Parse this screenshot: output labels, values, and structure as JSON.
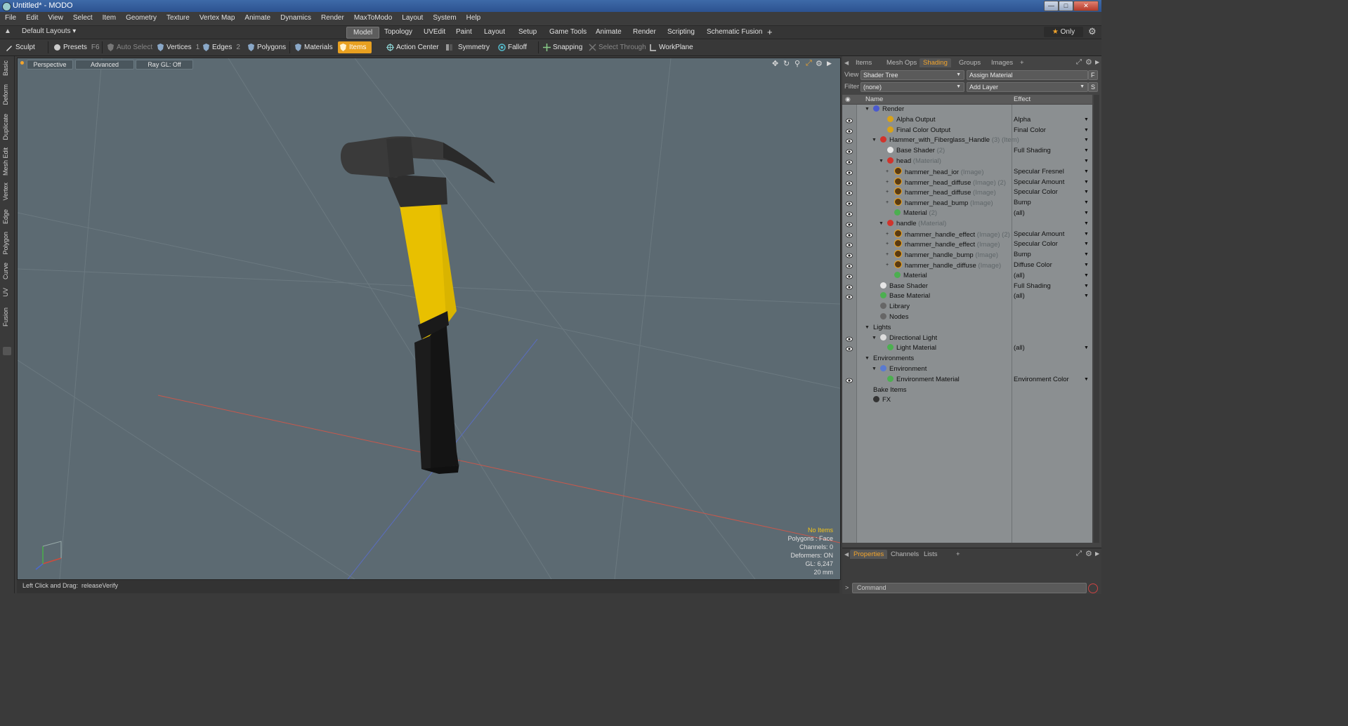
{
  "window": {
    "title": "Untitled* - MODO",
    "controls": [
      "minimize",
      "maximize",
      "close"
    ]
  },
  "menu": [
    "File",
    "Edit",
    "View",
    "Select",
    "Item",
    "Geometry",
    "Texture",
    "Vertex Map",
    "Animate",
    "Dynamics",
    "Render",
    "MaxToModo",
    "Layout",
    "System",
    "Help"
  ],
  "layout_bar": {
    "preset": "Default Layouts",
    "tabs": [
      "Model",
      "Topology",
      "UVEdit",
      "Paint",
      "Layout",
      "Setup",
      "Game Tools",
      "Animate",
      "Render",
      "Scripting",
      "Schematic Fusion"
    ],
    "active_tab": "Model",
    "add": "+",
    "only_label": "Only"
  },
  "toolbar": {
    "sculpt": "Sculpt",
    "presets": "Presets",
    "presets_key": "F6",
    "auto_select": "Auto Select",
    "vertices": "Vertices",
    "vertices_key": "1",
    "edges": "Edges",
    "edges_key": "2",
    "polygons": "Polygons",
    "materials": "Materials",
    "items": "Items",
    "action_center": "Action Center",
    "symmetry": "Symmetry",
    "falloff": "Falloff",
    "snapping": "Snapping",
    "select_through": "Select Through",
    "workplane": "WorkPlane"
  },
  "left_tabs": [
    "Basic",
    "Deform",
    "Duplicate",
    "Mesh Edit",
    "Vertex",
    "Edge",
    "Polygon",
    "Curve",
    "UV",
    "Fusion"
  ],
  "viewport": {
    "view": "Perspective",
    "shading": "Advanced",
    "raygl": "Ray GL: Off",
    "hud": {
      "selection": "No Items",
      "polygons": "Polygons : Face",
      "channels": "Channels: 0",
      "deformers": "Deformers: ON",
      "gl": "GL: 6,247",
      "scale": "20 mm"
    }
  },
  "status_bar": {
    "hint": "Left Click and Drag:",
    "action": "releaseVerify"
  },
  "right_panel": {
    "tabs": [
      "Items",
      "Mesh Ops",
      "Shading",
      "Groups",
      "Images",
      "+"
    ],
    "active_tab": "Shading",
    "view_label": "View",
    "view_value": "Shader Tree",
    "assign_material": "Assign Material",
    "f_button": "F",
    "filter_label": "Filter",
    "filter_value": "(none)",
    "add_layer": "Add Layer",
    "s_button": "S",
    "columns": {
      "name": "Name",
      "effect": "Effect"
    },
    "tree": [
      {
        "name": "Render",
        "sub": "",
        "effect": "",
        "icon": "sphere-blue",
        "level": 0,
        "eye": false,
        "toggle": "down"
      },
      {
        "name": "Alpha Output",
        "sub": "",
        "effect": "Alpha",
        "icon": "output",
        "level": 2,
        "eye": true,
        "toggle": ""
      },
      {
        "name": "Final Color Output",
        "sub": "",
        "effect": "Final Color",
        "icon": "output",
        "level": 2,
        "eye": true,
        "toggle": ""
      },
      {
        "name": "Hammer_with_Fiberglass_Handle",
        "sub": "(3) (Item)",
        "effect": "",
        "icon": "mask-red",
        "level": 1,
        "eye": true,
        "toggle": "down"
      },
      {
        "name": "Base Shader",
        "sub": "(2)",
        "effect": "Full Shading",
        "icon": "sphere-white",
        "level": 2,
        "eye": true,
        "toggle": ""
      },
      {
        "name": "head",
        "sub": "(Material)",
        "effect": "",
        "icon": "mask-red",
        "level": 2,
        "eye": true,
        "toggle": "down"
      },
      {
        "name": "hammer_head_ior",
        "sub": "(Image)",
        "effect": "Specular Fresnel",
        "icon": "image",
        "level": 3,
        "eye": true,
        "toggle": "plus"
      },
      {
        "name": "hammer_head_diffuse",
        "sub": "(Image) (2)",
        "effect": "Specular Amount",
        "icon": "image",
        "level": 3,
        "eye": true,
        "toggle": "plus"
      },
      {
        "name": "hammer_head_diffuse",
        "sub": "(Image)",
        "effect": "Specular Color",
        "icon": "image",
        "level": 3,
        "eye": true,
        "toggle": "plus"
      },
      {
        "name": "hammer_head_bump",
        "sub": "(Image)",
        "effect": "Bump",
        "icon": "image",
        "level": 3,
        "eye": true,
        "toggle": "plus"
      },
      {
        "name": "Material",
        "sub": "(2)",
        "effect": "(all)",
        "icon": "sphere-green",
        "level": 3,
        "eye": true,
        "toggle": ""
      },
      {
        "name": "handle",
        "sub": "(Material)",
        "effect": "",
        "icon": "mask-red",
        "level": 2,
        "eye": true,
        "toggle": "down"
      },
      {
        "name": "rhammer_handle_effect",
        "sub": "(Image) (2)",
        "effect": "Specular Amount",
        "icon": "image",
        "level": 3,
        "eye": true,
        "toggle": "plus"
      },
      {
        "name": "rhammer_handle_effect",
        "sub": "(Image)",
        "effect": "Specular Color",
        "icon": "image",
        "level": 3,
        "eye": true,
        "toggle": "plus"
      },
      {
        "name": "hammer_handle_bump",
        "sub": "(Image)",
        "effect": "Bump",
        "icon": "image",
        "level": 3,
        "eye": true,
        "toggle": "plus"
      },
      {
        "name": "hammer_handle_diffuse",
        "sub": "(Image)",
        "effect": "Diffuse Color",
        "icon": "image",
        "level": 3,
        "eye": true,
        "toggle": "plus"
      },
      {
        "name": "Material",
        "sub": "",
        "effect": "(all)",
        "icon": "sphere-green",
        "level": 3,
        "eye": true,
        "toggle": ""
      },
      {
        "name": "Base Shader",
        "sub": "",
        "effect": "Full Shading",
        "icon": "sphere-white",
        "level": 1,
        "eye": true,
        "toggle": ""
      },
      {
        "name": "Base Material",
        "sub": "",
        "effect": "(all)",
        "icon": "sphere-green",
        "level": 1,
        "eye": true,
        "toggle": ""
      },
      {
        "name": "Library",
        "sub": "",
        "effect": "",
        "icon": "folder",
        "level": 1,
        "eye": false,
        "toggle": ""
      },
      {
        "name": "Nodes",
        "sub": "",
        "effect": "",
        "icon": "folder",
        "level": 1,
        "eye": false,
        "toggle": ""
      },
      {
        "name": "Lights",
        "sub": "",
        "effect": "",
        "icon": "",
        "level": 0,
        "eye": false,
        "toggle": "down"
      },
      {
        "name": "Directional Light",
        "sub": "",
        "effect": "",
        "icon": "light",
        "level": 1,
        "eye": true,
        "toggle": "down"
      },
      {
        "name": "Light Material",
        "sub": "",
        "effect": "(all)",
        "icon": "sphere-green",
        "level": 2,
        "eye": true,
        "toggle": ""
      },
      {
        "name": "Environments",
        "sub": "",
        "effect": "",
        "icon": "",
        "level": 0,
        "eye": false,
        "toggle": "down"
      },
      {
        "name": "Environment",
        "sub": "",
        "effect": "",
        "icon": "env",
        "level": 1,
        "eye": false,
        "toggle": "down"
      },
      {
        "name": "Environment Material",
        "sub": "",
        "effect": "Environment Color",
        "icon": "sphere-green",
        "level": 2,
        "eye": true,
        "toggle": ""
      },
      {
        "name": "Bake Items",
        "sub": "",
        "effect": "",
        "icon": "",
        "level": 0,
        "eye": false,
        "toggle": ""
      },
      {
        "name": "FX",
        "sub": "",
        "effect": "",
        "icon": "clapper",
        "level": 0,
        "eye": false,
        "toggle": ""
      }
    ]
  },
  "lower_panel": {
    "tabs": [
      "Properties",
      "Channels",
      "Lists",
      "+"
    ],
    "active_tab": "Properties",
    "command_placeholder": "Command"
  },
  "colors": {
    "accent": "#f2a42c",
    "viewport_bg": "#5c6a72",
    "hammer_yellow": "#e8c000",
    "tree_bg": "#8b8f91"
  }
}
